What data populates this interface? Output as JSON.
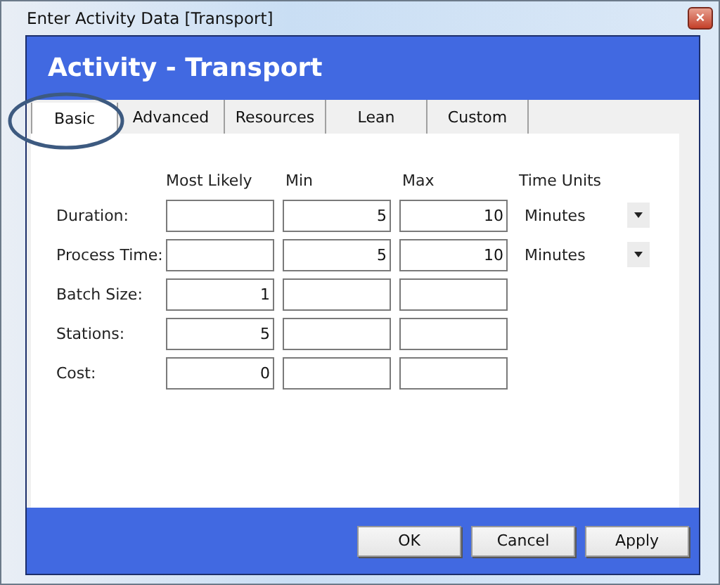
{
  "window": {
    "title": "Enter Activity Data [Transport]",
    "close": "×"
  },
  "header": {
    "title": "Activity - Transport"
  },
  "tabs": [
    {
      "label": "Basic",
      "selected": true
    },
    {
      "label": "Advanced",
      "selected": false
    },
    {
      "label": "Resources",
      "selected": false
    },
    {
      "label": "Lean",
      "selected": false
    },
    {
      "label": "Custom",
      "selected": false
    }
  ],
  "columns": [
    "Most Likely",
    "Min",
    "Max",
    "Time Units"
  ],
  "rows": [
    {
      "label": "Duration:",
      "min": "5",
      "max": "10",
      "time_units": "Minutes"
    },
    {
      "label": "Process Time:",
      "min": "5",
      "max": "10",
      "time_units": "Minutes"
    },
    {
      "label": "Batch Size:",
      "most_likely": "1"
    },
    {
      "label": "Stations:",
      "most_likely": "5"
    },
    {
      "label": "Cost:",
      "most_likely": "0"
    }
  ],
  "buttons": [
    "OK",
    "Cancel",
    "Apply"
  ]
}
